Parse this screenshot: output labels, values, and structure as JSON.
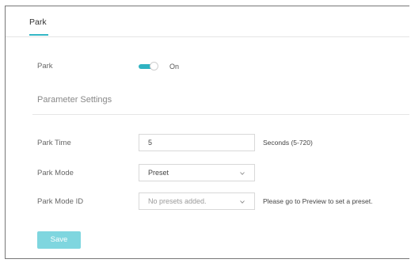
{
  "tabs": [
    {
      "label": "Park",
      "active": true
    }
  ],
  "park": {
    "label": "Park",
    "toggle_state": "On",
    "enabled": true
  },
  "section": {
    "title": "Parameter Settings"
  },
  "park_time": {
    "label": "Park Time",
    "value": "5",
    "hint": "Seconds (5-720)"
  },
  "park_mode": {
    "label": "Park Mode",
    "selected": "Preset"
  },
  "park_mode_id": {
    "label": "Park Mode ID",
    "selected": "No presets added.",
    "hint": "Please go to Preview to set a preset."
  },
  "actions": {
    "save_label": "Save"
  },
  "colors": {
    "accent": "#35b7c6",
    "save_button": "#7fd6df"
  }
}
